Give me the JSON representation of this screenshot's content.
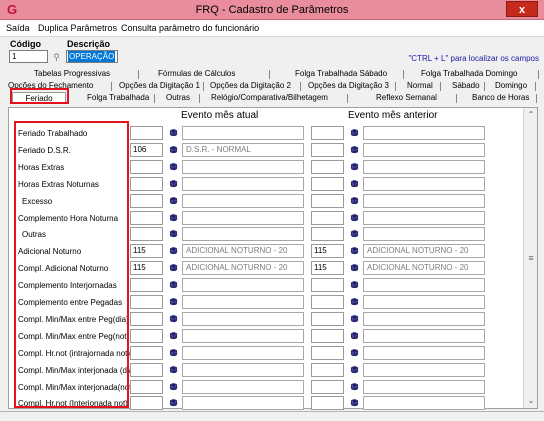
{
  "window": {
    "title": "FRQ - Cadastro de Parâmetros",
    "app_icon": "G",
    "close_label": "x"
  },
  "menu": [
    "Saída",
    "Duplica Parâmetros",
    "Consulta parâmetro do funcionário"
  ],
  "header": {
    "code_label": "Código",
    "code_value": "1",
    "desc_label": "Descrição",
    "desc_value": "OPERAÇÃO",
    "hint": "\"CTRL + L\" para localizar os campos"
  },
  "tabs_row1": [
    "Tabelas Progressivas",
    "Fórmulas de Cálculos",
    "Folga Trabalhada Sábado",
    "Folga Trabalhada Domingo"
  ],
  "tabs_row2": [
    "Opções do Fechamento",
    "Opções da Digitação 1",
    "Opções da Digitação 2",
    "Opções da Digitação 3",
    "Normal",
    "Sábado",
    "Domingo"
  ],
  "tabs_row3": [
    "Feriado",
    "Folga Trabalhada",
    "Outras",
    "Relógio/Comparativa/Bilhetagem",
    "Reflexo Semanal",
    "Banco de Horas"
  ],
  "active_tab": "Feriado",
  "columns": {
    "current": "Evento mês atual",
    "previous": "Evento mês anterior"
  },
  "rows": [
    {
      "label": "Feriado Trabalhado",
      "cur_code": "",
      "cur_desc": "",
      "prev_code": "",
      "prev_desc": ""
    },
    {
      "label": "Feriado D.S.R.",
      "cur_code": "106",
      "cur_desc": "D.S.R. - NORMAL",
      "prev_code": "",
      "prev_desc": ""
    },
    {
      "label": "Horas Extras",
      "cur_code": "",
      "cur_desc": "",
      "prev_code": "",
      "prev_desc": ""
    },
    {
      "label": "Horas Extras Noturnas",
      "cur_code": "",
      "cur_desc": "",
      "prev_code": "",
      "prev_desc": ""
    },
    {
      "label": "Excesso",
      "cur_code": "",
      "cur_desc": "",
      "prev_code": "",
      "prev_desc": ""
    },
    {
      "label": "Complemento Hora Noturna",
      "cur_code": "",
      "cur_desc": "",
      "prev_code": "",
      "prev_desc": ""
    },
    {
      "label": "Outras",
      "cur_code": "",
      "cur_desc": "",
      "prev_code": "",
      "prev_desc": ""
    },
    {
      "label": "Adicional Noturno",
      "cur_code": "115",
      "cur_desc": "ADICIONAL NOTURNO - 20",
      "prev_code": "115",
      "prev_desc": "ADICIONAL NOTURNO - 20"
    },
    {
      "label": "Compl. Adicional Noturno",
      "cur_code": "115",
      "cur_desc": "ADICIONAL NOTURNO - 20",
      "prev_code": "115",
      "prev_desc": "ADICIONAL NOTURNO - 20"
    },
    {
      "label": "Complemento Interjornadas",
      "cur_code": "",
      "cur_desc": "",
      "prev_code": "",
      "prev_desc": ""
    },
    {
      "label": "Complemento entre Pegadas",
      "cur_code": "",
      "cur_desc": "",
      "prev_code": "",
      "prev_desc": ""
    },
    {
      "label": "Compl. Min/Max entre Peg(dia)",
      "cur_code": "",
      "cur_desc": "",
      "prev_code": "",
      "prev_desc": ""
    },
    {
      "label": "Compl. Min/Max entre Peg(not)",
      "cur_code": "",
      "cur_desc": "",
      "prev_code": "",
      "prev_desc": ""
    },
    {
      "label": "Compl. Hr.not (intrajornada not)",
      "cur_code": "",
      "cur_desc": "",
      "prev_code": "",
      "prev_desc": ""
    },
    {
      "label": "Compl. Min/Max interjonada (dia)",
      "cur_code": "",
      "cur_desc": "",
      "prev_code": "",
      "prev_desc": ""
    },
    {
      "label": "Compl. Min/Max interjonada(not)",
      "cur_code": "",
      "cur_desc": "",
      "prev_code": "",
      "prev_desc": ""
    },
    {
      "label": "Compl. Hr.not (Interjonada not)",
      "cur_code": "",
      "cur_desc": "",
      "prev_code": "",
      "prev_desc": ""
    }
  ],
  "icons": {
    "lookup": "binoculars-icon",
    "search": "search-icon"
  },
  "colors": {
    "titlebar": "#e98d9d",
    "highlight": "#e3121d",
    "selection": "#0078d7",
    "hint": "#1a1aa8"
  }
}
